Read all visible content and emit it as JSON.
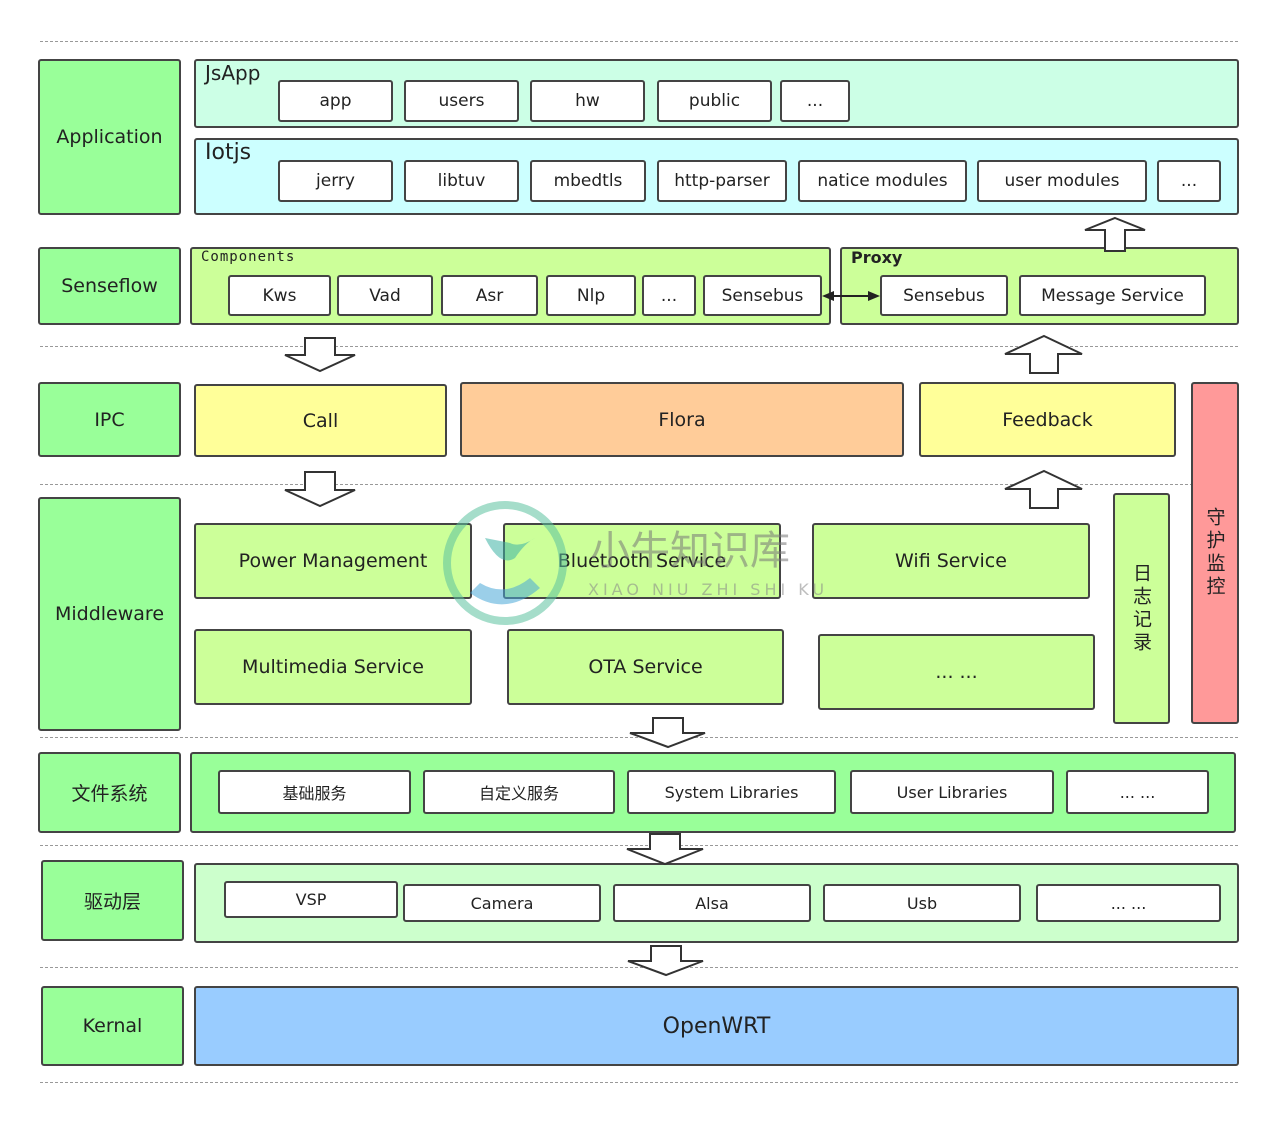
{
  "layers": {
    "application": "Application",
    "senseflow": "Senseflow",
    "ipc": "IPC",
    "middleware": "Middleware",
    "fs": "文件系统",
    "driver": "驱动层",
    "kernel": "Kernal"
  },
  "jsapp": {
    "title": "JsApp",
    "items": [
      "app",
      "users",
      "hw",
      "public",
      "..."
    ]
  },
  "iotjs": {
    "title": "Iotjs",
    "items": [
      "jerry",
      "libtuv",
      "mbedtls",
      "http-parser",
      "natice modules",
      "user modules",
      "..."
    ]
  },
  "components": {
    "title": "Components",
    "items": [
      "Kws",
      "Vad",
      "Asr",
      "Nlp",
      "...",
      "Sensebus"
    ]
  },
  "proxy": {
    "title": "Proxy",
    "items": [
      "Sensebus",
      "Message Service"
    ]
  },
  "ipc": {
    "call": "Call",
    "flora": "Flora",
    "feedback": "Feedback"
  },
  "middleware": {
    "items": [
      "Power Management",
      "Bluetooth Service",
      "Wifi Service",
      "Multimedia Service",
      "OTA Service",
      "... ..."
    ],
    "log": "日志记录",
    "guard": "守护监控"
  },
  "fs": {
    "items": [
      "基础服务",
      "自定义服务",
      "System Libraries",
      "User Libraries",
      "... ..."
    ]
  },
  "driver": {
    "items": [
      "VSP",
      "Camera",
      "Alsa",
      "Usb",
      "... ..."
    ]
  },
  "kernel": {
    "os": "OpenWRT"
  },
  "watermark": {
    "cn": "小牛知识库",
    "pinyin": "XIAO NIU ZHI SHI KU"
  },
  "colors": {
    "layer": "#99ff99",
    "jsapp": "#ccffe6",
    "iotjs": "#ccffff",
    "senseflow": "#ccff99",
    "call": "#ffff99",
    "flora": "#ffcc99",
    "guard": "#ff9999",
    "driver": "#ccffcc",
    "kernel": "#99ccff"
  }
}
